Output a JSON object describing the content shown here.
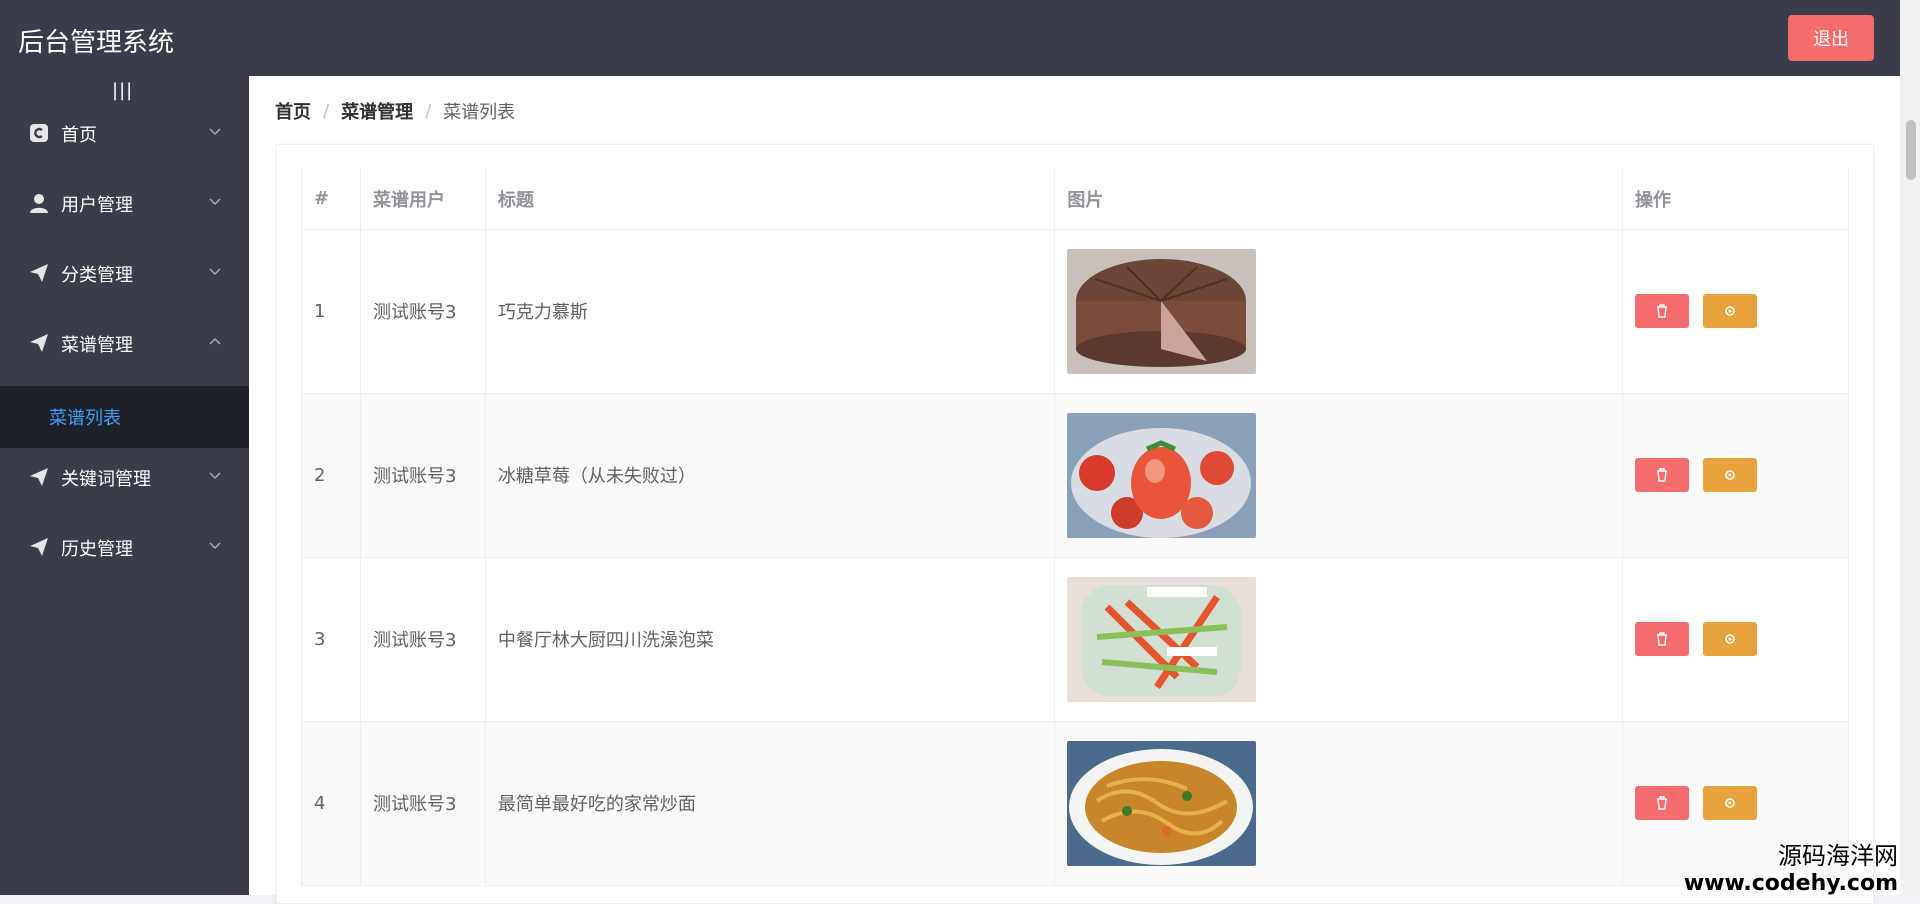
{
  "header": {
    "title": "后台管理系统",
    "logout_label": "退出"
  },
  "sidebar": {
    "collapse_glyph": "|||",
    "items": [
      {
        "label": "首页",
        "icon": "home-icon"
      },
      {
        "label": "用户管理",
        "icon": "user-icon"
      },
      {
        "label": "分类管理",
        "icon": "send-icon"
      },
      {
        "label": "菜谱管理",
        "icon": "send-icon",
        "expanded": true
      },
      {
        "label": "关键词管理",
        "icon": "send-icon"
      },
      {
        "label": "历史管理",
        "icon": "send-icon"
      }
    ],
    "sub_item": {
      "label": "菜谱列表"
    }
  },
  "breadcrumb": {
    "home": "首页",
    "section": "菜谱管理",
    "current": "菜谱列表"
  },
  "table": {
    "headers": [
      "#",
      "菜谱用户",
      "标题",
      "图片",
      "操作"
    ],
    "rows": [
      {
        "index": "1",
        "user": "测试账号3",
        "title": "巧克力慕斯",
        "image": "chocolate-mousse"
      },
      {
        "index": "2",
        "user": "测试账号3",
        "title": "冰糖草莓（从未失败过）",
        "image": "candied-strawberries"
      },
      {
        "index": "3",
        "user": "测试账号3",
        "title": "中餐厅林大厨四川洗澡泡菜",
        "image": "sichuan-pickles"
      },
      {
        "index": "4",
        "user": "测试账号3",
        "title": "最简单最好吃的家常炒面",
        "image": "fried-noodles"
      }
    ]
  },
  "watermark": {
    "line1": "源码海洋网",
    "line2": "www.codehy.com"
  },
  "colors": {
    "header_bg": "#393d49",
    "danger": "#f56c6c",
    "warning": "#e6a23c",
    "active": "#409eff"
  }
}
